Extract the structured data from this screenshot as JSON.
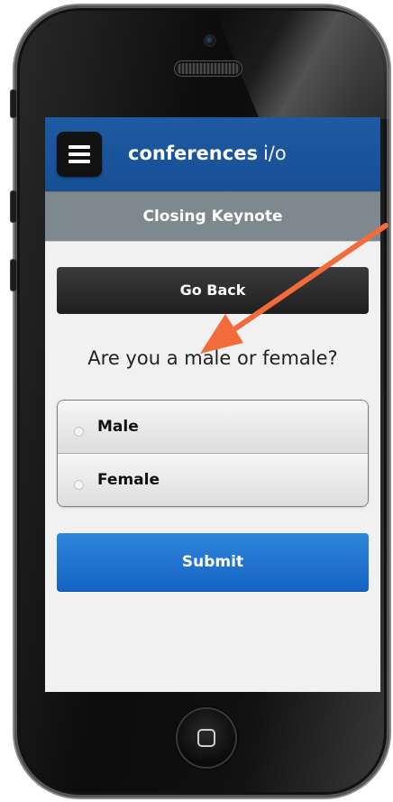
{
  "header": {
    "brand_name": "conferences",
    "brand_suffix": "i/o"
  },
  "subheader": {
    "title": "Closing Keynote"
  },
  "buttons": {
    "go_back": "Go Back",
    "submit": "Submit"
  },
  "poll": {
    "question": "Are you a male or female?",
    "options": [
      {
        "label": "Male",
        "selected": false
      },
      {
        "label": "Female",
        "selected": false
      }
    ]
  },
  "colors": {
    "header_blue": "#1e5aa3",
    "subheader_gray": "#7e888f",
    "submit_blue": "#1d6fd0",
    "annotation_arrow": "#f26b3a"
  },
  "icons": {
    "menu": "hamburger-menu-icon",
    "home": "home-button-icon",
    "annotation": "orange-arrow"
  }
}
